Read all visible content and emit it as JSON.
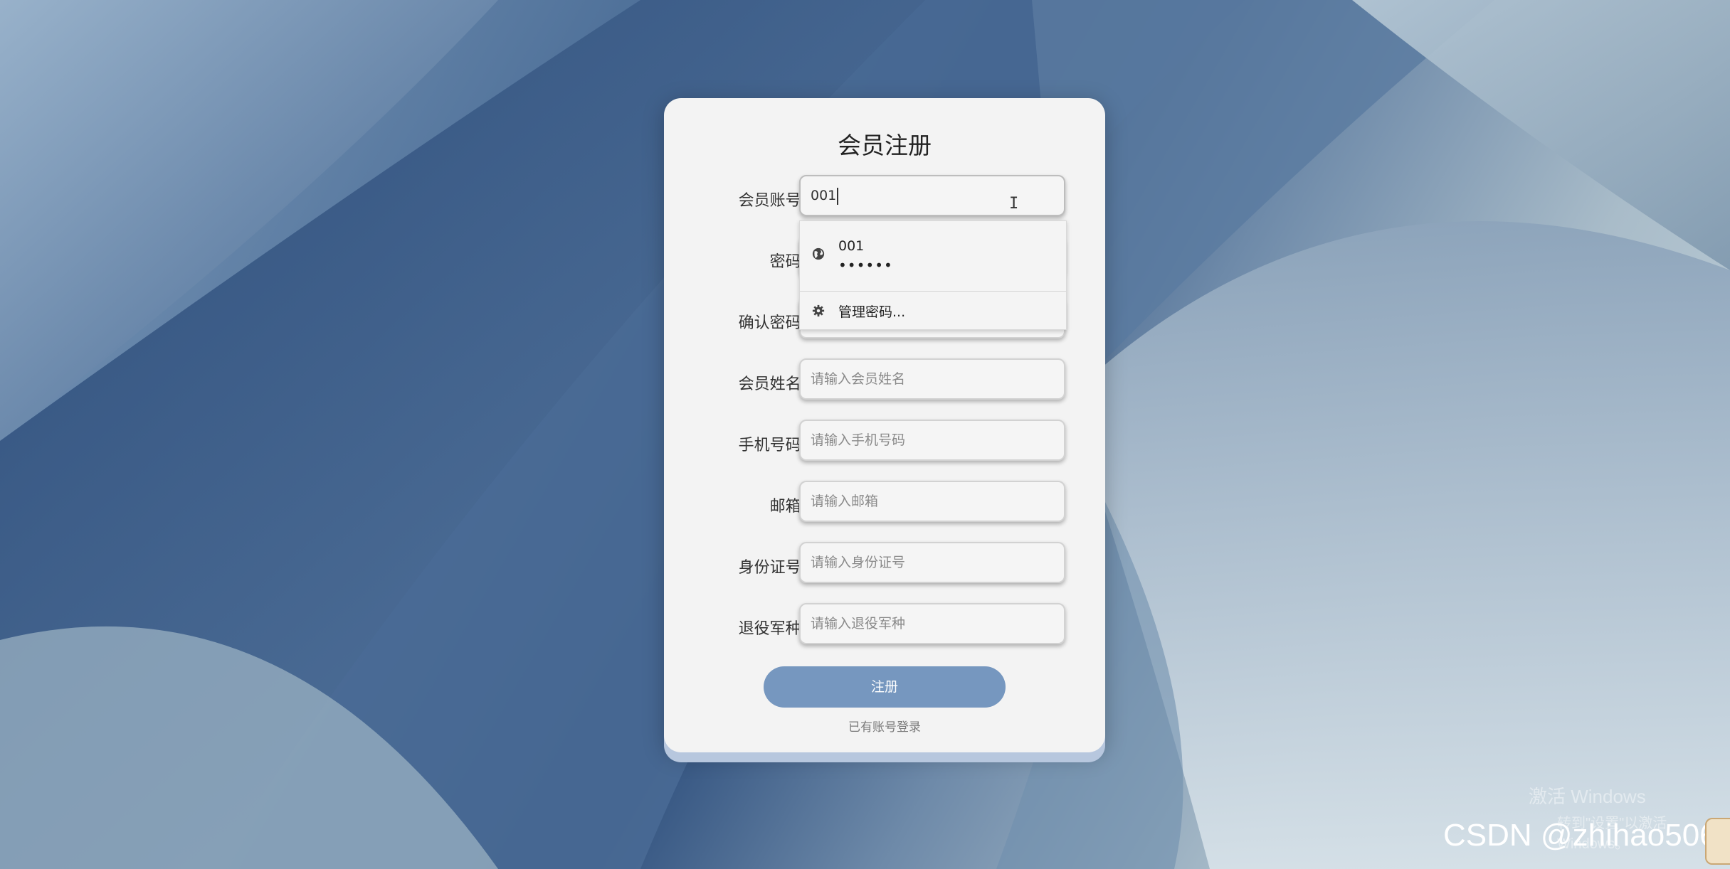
{
  "form": {
    "title": "会员注册",
    "fields": [
      {
        "label": "会员账号:",
        "value": "001",
        "placeholder": ""
      },
      {
        "label": "密码:",
        "value": "",
        "placeholder": ""
      },
      {
        "label": "确认密码:",
        "value": "",
        "placeholder": ""
      },
      {
        "label": "会员姓名:",
        "value": "",
        "placeholder": "请输入会员姓名"
      },
      {
        "label": "手机号码:",
        "value": "",
        "placeholder": "请输入手机号码"
      },
      {
        "label": "邮箱:",
        "value": "",
        "placeholder": "请输入邮箱"
      },
      {
        "label": "身份证号:",
        "value": "",
        "placeholder": "请输入身份证号"
      },
      {
        "label": "退役军种:",
        "value": "",
        "placeholder": "请输入退役军种"
      }
    ],
    "submit_label": "注册",
    "login_link": "已有账号登录"
  },
  "autocomplete": {
    "username": "001",
    "password_mask": "••••••",
    "manage_label": "管理密码...",
    "icons": [
      "globe-icon",
      "gear-icon"
    ]
  },
  "overlay": {
    "activate_line1": "激活 Windows",
    "activate_line2": "转到\"设置\"以激活 Windows。",
    "watermark": "CSDN @zhihao506"
  },
  "colors": {
    "card_bg": "#f3f3f3",
    "button_bg": "#7697bf",
    "card_shadow_accent": "#b7c7de"
  }
}
